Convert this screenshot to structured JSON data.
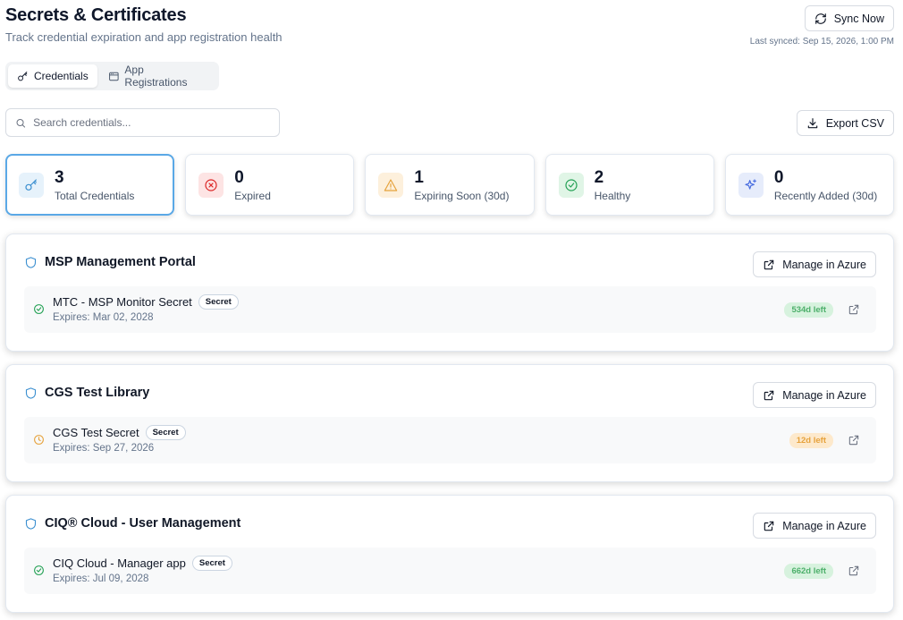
{
  "header": {
    "title": "Secrets & Certificates",
    "subtitle": "Track credential expiration and app registration health",
    "sync_label": "Sync Now",
    "last_synced": "Last synced: Sep 15, 2026, 1:00 PM"
  },
  "tabs": [
    {
      "label": "Credentials",
      "icon": "key-icon",
      "active": true
    },
    {
      "label": "App Registrations",
      "icon": "window-icon",
      "active": false
    }
  ],
  "search": {
    "placeholder": "Search credentials..."
  },
  "export": {
    "label": "Export CSV"
  },
  "stats": [
    {
      "value": "3",
      "label": "Total Credentials",
      "icon": "key-icon",
      "color": "#3b8fd0",
      "bg": "#e6f2fb"
    },
    {
      "value": "0",
      "label": "Expired",
      "icon": "x-circle-icon",
      "color": "#dc2626",
      "bg": "#fde4e4"
    },
    {
      "value": "1",
      "label": "Expiring Soon (30d)",
      "icon": "warning-icon",
      "color": "#e6a23c",
      "bg": "#fdf0dc"
    },
    {
      "value": "2",
      "label": "Healthy",
      "icon": "check-circle-icon",
      "color": "#22a053",
      "bg": "#e0f5e6"
    },
    {
      "value": "0",
      "label": "Recently Added (30d)",
      "icon": "sparkles-icon",
      "color": "#4a6ee0",
      "bg": "#e6ecfb"
    }
  ],
  "apps": [
    {
      "name": "MSP Management Portal",
      "manage_label": "Manage in Azure",
      "credential": {
        "name": "MTC - MSP Monitor Secret",
        "type": "Secret",
        "expiry": "Expires: Mar 02, 2028",
        "days_left": "534d left",
        "status": "ok"
      }
    },
    {
      "name": "CGS Test Library",
      "manage_label": "Manage in Azure",
      "credential": {
        "name": "CGS Test Secret",
        "type": "Secret",
        "expiry": "Expires: Sep 27, 2026",
        "days_left": "12d left",
        "status": "warn"
      }
    },
    {
      "name": "CIQ® Cloud - User Management",
      "manage_label": "Manage in Azure",
      "credential": {
        "name": "CIQ Cloud - Manager app",
        "type": "Secret",
        "expiry": "Expires: Jul 09, 2028",
        "days_left": "662d left",
        "status": "ok"
      }
    }
  ],
  "colors": {
    "ok": "#22a053",
    "warn": "#e6a23c",
    "accent": "#3b8fd0"
  }
}
